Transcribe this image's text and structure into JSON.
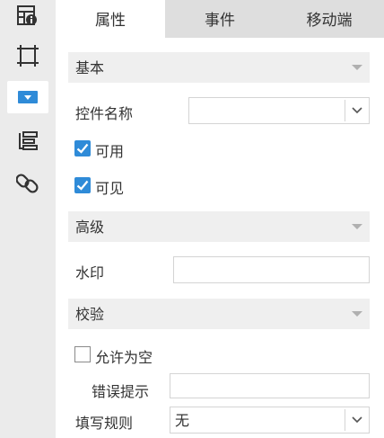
{
  "rail": {
    "items": [
      {
        "icon": "report-info-icon"
      },
      {
        "icon": "frame-icon"
      },
      {
        "icon": "dropdown-widget-icon",
        "active": true
      },
      {
        "icon": "layout-icon"
      },
      {
        "icon": "link-icon"
      }
    ]
  },
  "tabs": [
    "属性",
    "事件",
    "移动端"
  ],
  "sections": {
    "basic": "基本",
    "advanced": "高级",
    "validation": "校验"
  },
  "fields": {
    "widget_name_label": "控件名称",
    "widget_name_value": "",
    "enabled_label": "可用",
    "enabled_checked": true,
    "visible_label": "可见",
    "visible_checked": true,
    "watermark_label": "水印",
    "watermark_value": "",
    "allow_empty_label": "允许为空",
    "allow_empty_checked": false,
    "error_hint_label": "错误提示",
    "error_hint_value": "",
    "fill_rule_label": "填写规则",
    "fill_rule_value": "无"
  },
  "colors": {
    "accent": "#2f8bd8",
    "rail_bg": "#ebebeb",
    "tab_bg": "#dedede",
    "section_bg": "#efefef"
  }
}
